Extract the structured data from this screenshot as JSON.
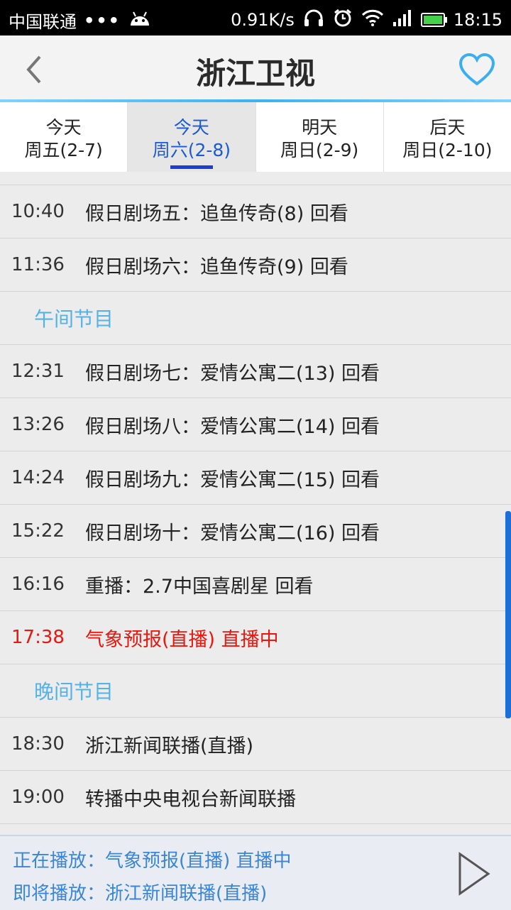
{
  "status": {
    "carrier": "中国联通",
    "dots": "•••",
    "speed": "0.91K/s",
    "time": "18:15"
  },
  "header": {
    "title": "浙江卫视"
  },
  "tabs": [
    {
      "day": "今天",
      "date": "周五(2-7)"
    },
    {
      "day": "今天",
      "date": "周六(2-8)"
    },
    {
      "day": "明天",
      "date": "周日(2-9)"
    },
    {
      "day": "后天",
      "date": "周日(2-10)"
    }
  ],
  "schedule": [
    {
      "type": "item",
      "time": "10:40",
      "name": "假日剧场五：追鱼传奇(8) 回看"
    },
    {
      "type": "item",
      "time": "11:36",
      "name": "假日剧场六：追鱼传奇(9) 回看"
    },
    {
      "type": "section",
      "label": "午间节目"
    },
    {
      "type": "item",
      "time": "12:31",
      "name": "假日剧场七：爱情公寓二(13) 回看"
    },
    {
      "type": "item",
      "time": "13:26",
      "name": "假日剧场八：爱情公寓二(14) 回看"
    },
    {
      "type": "item",
      "time": "14:24",
      "name": "假日剧场九：爱情公寓二(15) 回看"
    },
    {
      "type": "item",
      "time": "15:22",
      "name": "假日剧场十：爱情公寓二(16) 回看"
    },
    {
      "type": "item",
      "time": "16:16",
      "name": "重播：2.7中国喜剧星 回看"
    },
    {
      "type": "item",
      "time": "17:38",
      "name": "气象预报(直播) 直播中",
      "live": true
    },
    {
      "type": "section",
      "label": "晚间节目"
    },
    {
      "type": "item",
      "time": "18:30",
      "name": "浙江新闻联播(直播)"
    },
    {
      "type": "item",
      "time": "19:00",
      "name": "转播中央电视台新闻联播"
    }
  ],
  "bottom": {
    "now_playing": "正在播放：气象预报(直播) 直播中",
    "up_next": "即将播放：浙江新闻联播(直播)"
  },
  "colors": {
    "accent": "#3ab3f0",
    "live": "#e8170f",
    "section": "#55b2e6",
    "active_tab_text": "#1a5ad6"
  }
}
